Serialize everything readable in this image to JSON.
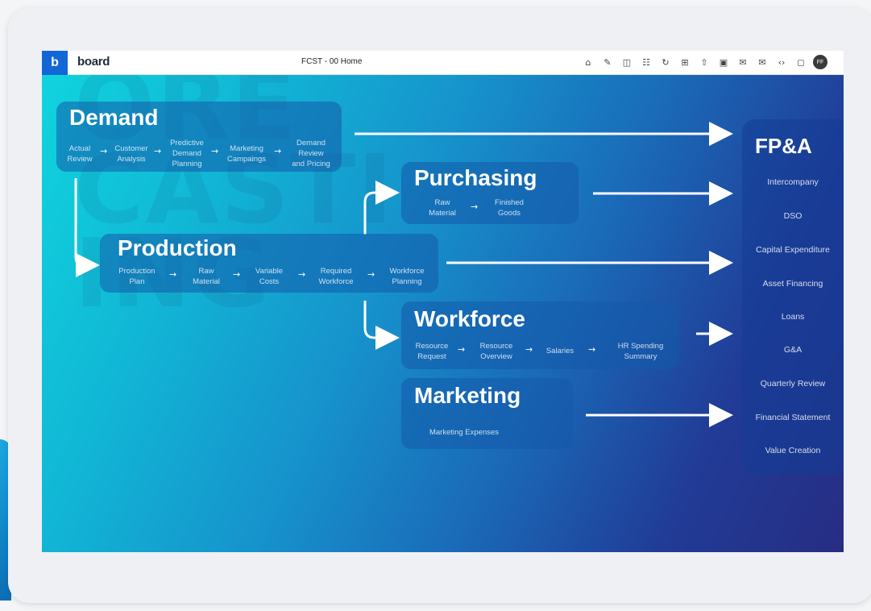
{
  "app": {
    "logo_letter": "b",
    "brand": "board",
    "page_title": "FCST - 00 Home"
  },
  "toolbar": {
    "icons": [
      "home-icon",
      "edit-icon",
      "panel-icon",
      "layout-icon",
      "refresh-icon",
      "present-icon",
      "share-icon",
      "excel-icon",
      "send-icon",
      "mail-icon",
      "code-icon",
      "chat-icon"
    ],
    "avatar_initials": "FF"
  },
  "watermark": {
    "line1": "ORE",
    "line2": "CASTI",
    "line3": "ING"
  },
  "demand": {
    "title": "Demand",
    "steps": [
      [
        "Actual",
        "Review"
      ],
      [
        "Customer",
        "Analysis"
      ],
      [
        "Predictive",
        "Demand",
        "Planning"
      ],
      [
        "Marketing",
        "Campaings"
      ],
      [
        "Demand",
        "Review",
        "and Pricing"
      ]
    ]
  },
  "purchasing": {
    "title": "Purchasing",
    "steps": [
      [
        "Raw",
        "Material"
      ],
      [
        "Finished",
        "Goods"
      ]
    ]
  },
  "production": {
    "title": "Production",
    "steps": [
      [
        "Production",
        "Plan"
      ],
      [
        "Raw",
        "Material"
      ],
      [
        "Variable",
        "Costs"
      ],
      [
        "Required",
        "Workforce"
      ],
      [
        "Workforce",
        "Planning"
      ]
    ]
  },
  "workforce": {
    "title": "Workforce",
    "steps": [
      [
        "Resource",
        "Request"
      ],
      [
        "Resource",
        "Overview"
      ],
      [
        "Salaries"
      ],
      [
        "HR Spending",
        "Summary"
      ]
    ]
  },
  "marketing": {
    "title": "Marketing",
    "steps": [
      [
        "Marketing Expenses"
      ]
    ]
  },
  "fpa": {
    "title": "FP&A",
    "items": [
      "Intercompany",
      "DSO",
      "Capital Expenditure",
      "Asset Financing",
      "Loans",
      "G&A",
      "Quarterly Review",
      "Financial Statement",
      "Value Creation"
    ]
  },
  "arrow_glyph": "→",
  "colors": {
    "accent": "#1366d6",
    "box_fill": "#145aaa",
    "gradient_start": "#10d4de",
    "gradient_end": "#272d83"
  }
}
